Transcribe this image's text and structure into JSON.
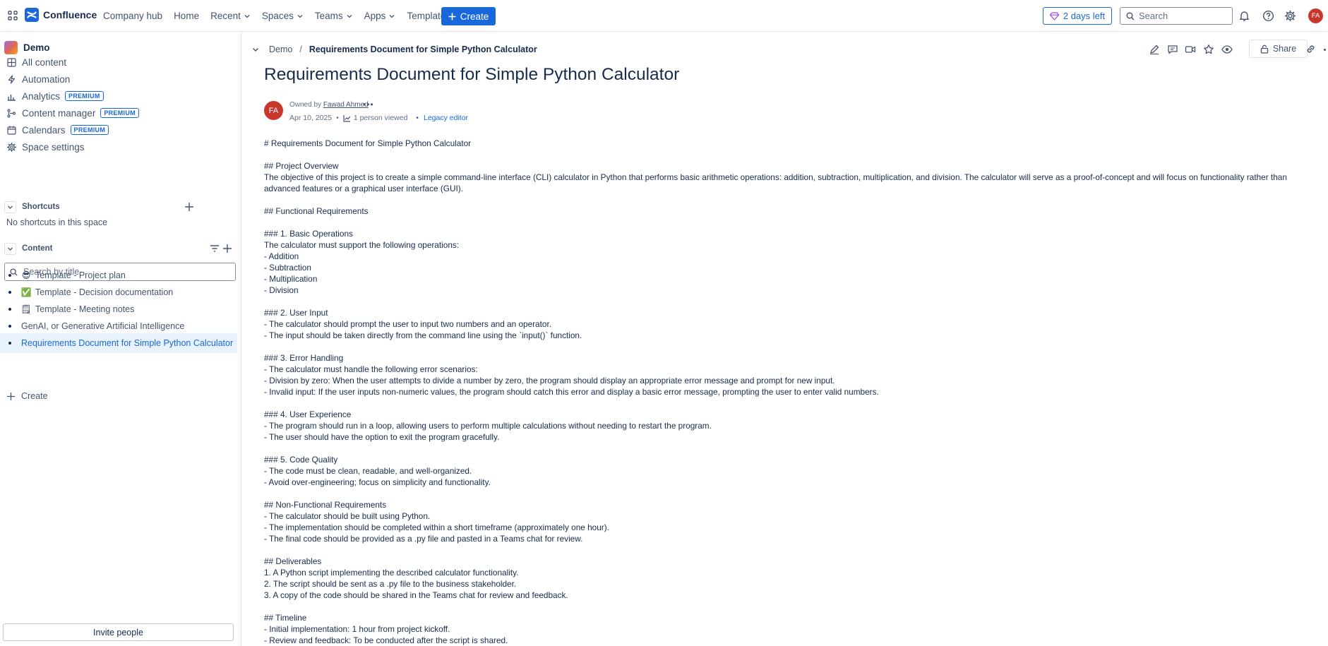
{
  "topnav": {
    "product": "Confluence",
    "items": [
      {
        "label": "Company hub",
        "dropdown": false
      },
      {
        "label": "Home",
        "dropdown": false
      },
      {
        "label": "Recent",
        "dropdown": true
      },
      {
        "label": "Spaces",
        "dropdown": true
      },
      {
        "label": "Teams",
        "dropdown": true
      },
      {
        "label": "Apps",
        "dropdown": true
      },
      {
        "label": "Templates",
        "dropdown": false
      }
    ],
    "create_label": "Create",
    "trial_label": "2 days left",
    "search_placeholder": "Search",
    "user_initials": "FA",
    "accent_color": "#1868db"
  },
  "sidebar": {
    "space_name": "Demo",
    "items": [
      {
        "label": "All content",
        "icon": "grid-icon",
        "badge": ""
      },
      {
        "label": "Automation",
        "icon": "lightning-icon",
        "badge": ""
      },
      {
        "label": "Analytics",
        "icon": "bar-chart-icon",
        "badge": "PREMIUM"
      },
      {
        "label": "Content manager",
        "icon": "content-manager-icon",
        "badge": "PREMIUM"
      },
      {
        "label": "Calendars",
        "icon": "calendar-icon",
        "badge": "PREMIUM"
      },
      {
        "label": "Space settings",
        "icon": "gear-icon",
        "badge": ""
      }
    ],
    "shortcuts": {
      "title": "Shortcuts",
      "empty_text": "No shortcuts in this space"
    },
    "content": {
      "title": "Content",
      "search_placeholder": "Search by title",
      "tree": [
        {
          "emoji": "😎",
          "label": "Template - Project plan",
          "active": false
        },
        {
          "emoji": "✅",
          "label": "Template - Decision documentation",
          "active": false
        },
        {
          "emoji": "🗒",
          "label": "Template - Meeting notes",
          "active": false
        },
        {
          "emoji": "",
          "label": "GenAI, or Generative Artificial Intelligence",
          "active": false
        },
        {
          "emoji": "",
          "label": "Requirements Document for Simple Python Calculator",
          "active": true
        }
      ],
      "create_label": "Create"
    },
    "invite_label": "Invite people"
  },
  "page": {
    "breadcrumb": {
      "space": "Demo",
      "separator": "/",
      "current": "Requirements Document for Simple Python Calculator"
    },
    "share_label": "Share",
    "title": "Requirements Document for Simple Python Calculator",
    "byline": {
      "owned_prefix": "Owned by",
      "author": "Fawad Ahmed",
      "author_initials": "FA",
      "more": "•••",
      "date": "Apr 10, 2025",
      "views": "1 person viewed",
      "editor": "Legacy editor"
    },
    "body": [
      "# Requirements Document for Simple Python Calculator",
      "",
      "## Project Overview",
      "The objective of this project is to create a simple command-line interface (CLI) calculator in Python that performs basic arithmetic operations: addition, subtraction, multiplication, and division. The calculator will serve as a proof-of-concept and will focus on functionality rather than advanced features or a graphical user interface (GUI).",
      "",
      "## Functional Requirements",
      "",
      "### 1. Basic Operations",
      "The calculator must support the following operations:",
      "- Addition",
      "- Subtraction",
      "- Multiplication",
      "- Division",
      "",
      "### 2. User Input",
      "- The calculator should prompt the user to input two numbers and an operator.",
      "- The input should be taken directly from the command line using the `input()` function.",
      "",
      "### 3. Error Handling",
      "- The calculator must handle the following error scenarios:",
      "- Division by zero: When the user attempts to divide a number by zero, the program should display an appropriate error message and prompt for new input.",
      "- Invalid input: If the user inputs non-numeric values, the program should catch this error and display a basic error message, prompting the user to enter valid numbers.",
      "",
      "### 4. User Experience",
      "- The program should run in a loop, allowing users to perform multiple calculations without needing to restart the program.",
      "- The user should have the option to exit the program gracefully.",
      "",
      "### 5. Code Quality",
      "- The code must be clean, readable, and well-organized.",
      "- Avoid over-engineering; focus on simplicity and functionality.",
      "",
      "## Non-Functional Requirements",
      "- The calculator should be built using Python.",
      "- The implementation should be completed within a short timeframe (approximately one hour).",
      "- The final code should be provided as a .py file and pasted in a Teams chat for review.",
      "",
      "## Deliverables",
      "1. A Python script implementing the described calculator functionality.",
      "2. The script should be sent as a .py file to the business stakeholder.",
      "3. A copy of the code should be shared in the Teams chat for review and feedback.",
      "",
      "## Timeline",
      "- Initial implementation: 1 hour from project kickoff.",
      "- Review and feedback: To be conducted after the script is shared."
    ]
  }
}
